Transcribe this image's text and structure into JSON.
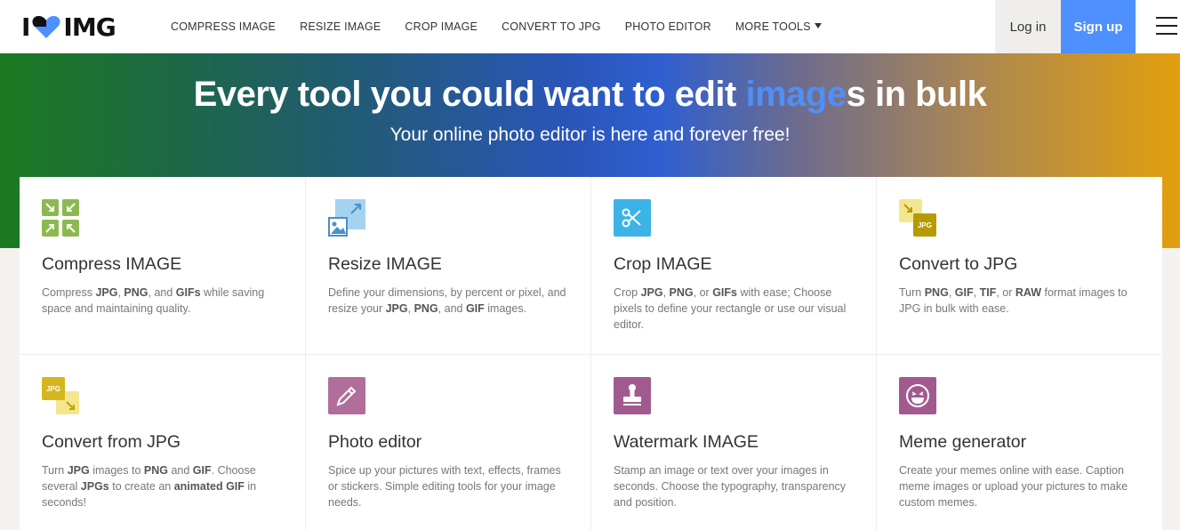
{
  "logo": {
    "i": "I",
    "text": "IMG"
  },
  "nav": {
    "items": [
      "COMPRESS IMAGE",
      "RESIZE IMAGE",
      "CROP IMAGE",
      "CONVERT TO JPG",
      "PHOTO EDITOR",
      "MORE TOOLS"
    ]
  },
  "auth": {
    "login": "Log in",
    "signup": "Sign up"
  },
  "hero": {
    "title_part1": "Every tool you could want to edit ",
    "title_highlight": "image",
    "title_part2": "s in bulk",
    "subtitle": "Your online photo editor is here and forever free!"
  },
  "colors": {
    "accent_blue": "#4d90fe",
    "compress_icon": "#8cb94f",
    "resize_icon": "#a4d3f0",
    "crop_icon": "#3bb3e6",
    "jpg_icon": "#c2a200",
    "photo_editor_icon": "#b16e9b",
    "watermark_icon": "#a15a8f",
    "meme_icon": "#a15a8f"
  },
  "tools": [
    {
      "title": "Compress IMAGE",
      "icon": "compress-icon",
      "desc": [
        [
          "Compress ",
          false
        ],
        [
          "JPG",
          true
        ],
        [
          ", ",
          false
        ],
        [
          "PNG",
          true
        ],
        [
          ", and ",
          false
        ],
        [
          "GIFs",
          true
        ],
        [
          " while saving space and maintaining quality.",
          false
        ]
      ]
    },
    {
      "title": "Resize IMAGE",
      "icon": "resize-icon",
      "desc": [
        [
          "Define your dimensions, by percent or pixel, and resize your ",
          false
        ],
        [
          "JPG",
          true
        ],
        [
          ", ",
          false
        ],
        [
          "PNG",
          true
        ],
        [
          ", and ",
          false
        ],
        [
          "GIF",
          true
        ],
        [
          " images.",
          false
        ]
      ]
    },
    {
      "title": "Crop IMAGE",
      "icon": "scissors-icon",
      "desc": [
        [
          "Crop ",
          false
        ],
        [
          "JPG",
          true
        ],
        [
          ", ",
          false
        ],
        [
          "PNG",
          true
        ],
        [
          ", or ",
          false
        ],
        [
          "GIFs",
          true
        ],
        [
          " with ease; Choose pixels to define your rectangle or use our visual editor.",
          false
        ]
      ]
    },
    {
      "title": "Convert to JPG",
      "icon": "convert-to-jpg-icon",
      "desc": [
        [
          "Turn ",
          false
        ],
        [
          "PNG",
          true
        ],
        [
          ", ",
          false
        ],
        [
          "GIF",
          true
        ],
        [
          ", ",
          false
        ],
        [
          "TIF",
          true
        ],
        [
          ", or ",
          false
        ],
        [
          "RAW",
          true
        ],
        [
          " format images to JPG in bulk with ease.",
          false
        ]
      ]
    },
    {
      "title": "Convert from JPG",
      "icon": "convert-from-jpg-icon",
      "desc": [
        [
          "Turn ",
          false
        ],
        [
          "JPG",
          true
        ],
        [
          " images to ",
          false
        ],
        [
          "PNG",
          true
        ],
        [
          " and ",
          false
        ],
        [
          "GIF",
          true
        ],
        [
          ". Choose several ",
          false
        ],
        [
          "JPGs",
          true
        ],
        [
          " to create an ",
          false
        ],
        [
          "animated GIF",
          true
        ],
        [
          " in seconds!",
          false
        ]
      ]
    },
    {
      "title": "Photo editor",
      "icon": "pencil-icon",
      "desc": [
        [
          "Spice up your pictures with text, effects, frames or stickers. Simple editing tools for your image needs.",
          false
        ]
      ]
    },
    {
      "title": "Watermark IMAGE",
      "icon": "stamp-icon",
      "desc": [
        [
          "Stamp an image or text over your images in seconds. Choose the typography, transparency and position.",
          false
        ]
      ]
    },
    {
      "title": "Meme generator",
      "icon": "laughing-face-icon",
      "desc": [
        [
          "Create your memes online with ease. Caption meme images or upload your pictures to make custom memes.",
          false
        ]
      ]
    }
  ],
  "jpg_badge": "JPG"
}
